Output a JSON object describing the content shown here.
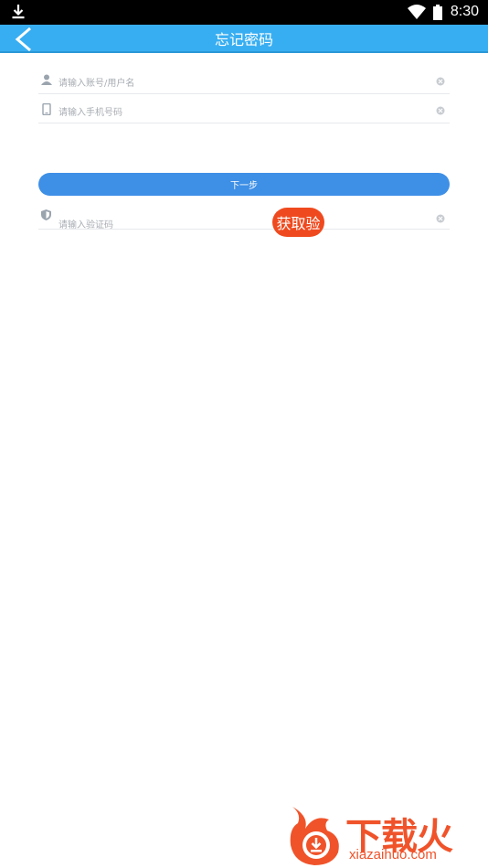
{
  "status_bar": {
    "time": "8:30",
    "icons": [
      "download-icon",
      "wifi-icon",
      "battery-icon"
    ]
  },
  "header": {
    "title": "忘记密码",
    "back_icon": "chevron-left-icon",
    "color": "#38aef2"
  },
  "form": {
    "account_placeholder": "请输入账号/用户名",
    "phone_placeholder": "请输入手机号码",
    "next_label": "下一步",
    "code_placeholder": "请输入验证码",
    "get_code_label": "获取验"
  },
  "watermark": {
    "brand": "下载火",
    "site": "xiazaihuo.com"
  },
  "colors": {
    "primary": "#3e8fe6",
    "accent": "#ef4a1f"
  }
}
